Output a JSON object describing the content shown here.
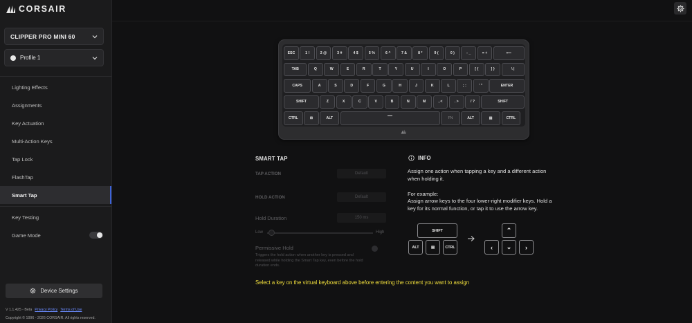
{
  "brand": {
    "name": "CORSAIR"
  },
  "device": {
    "name": "CLIPPER PRO MINI 60"
  },
  "profile": {
    "name": "Profile 1"
  },
  "nav": {
    "items": [
      "Lighting Effects",
      "Assignments",
      "Key Actuation",
      "Multi-Action Keys",
      "Tap Lock",
      "FlashTap",
      "Smart Tap"
    ],
    "active": "Smart Tap",
    "key_testing": "Key Testing",
    "game_mode": "Game Mode"
  },
  "device_settings_label": "Device Settings",
  "footer": {
    "version": "V 1.1.425 - Beta",
    "privacy": "Privacy Policy",
    "terms": "Terms of Use",
    "copyright": "Copyright © 1996 - 2026 CORSAIR. All rights reserved."
  },
  "keyboard": {
    "rows": [
      [
        "ESC",
        "1 !",
        "2 @",
        "3 #",
        "4 $",
        "5 %",
        "6 ^",
        "7 &",
        "8 *",
        "9 (",
        "0 )",
        "- _",
        "= +",
        "⟵"
      ],
      [
        "TAB",
        "Q",
        "W",
        "E",
        "R",
        "T",
        "Y",
        "U",
        "I",
        "O",
        "P",
        "[ {",
        "] }",
        "\\ |"
      ],
      [
        "CAPS",
        "A",
        "S",
        "D",
        "F",
        "G",
        "H",
        "J",
        "K",
        "L",
        "; :",
        "' \"",
        "ENTER"
      ],
      [
        "SHIFT",
        "Z",
        "X",
        "C",
        "V",
        "B",
        "N",
        "M",
        ", <",
        ". >",
        "/ ?",
        "SHIFT"
      ],
      [
        "CTRL",
        "⊞",
        "ALT",
        "",
        "FN",
        "ALT",
        "▤",
        "CTRL"
      ]
    ]
  },
  "smart_tap": {
    "title": "SMART TAP",
    "tap_action_label": "TAP ACTION",
    "tap_action_value": "Default",
    "hold_action_label": "HOLD ACTION",
    "hold_action_value": "Default",
    "hold_duration_label": "Hold Duration",
    "hold_duration_value": "150 ms",
    "slider_low": "Low",
    "slider_high": "High",
    "permissive_label": "Permissive Hold",
    "permissive_desc": "Triggers the hold action when another key is pressed and released while holding the Smart Tap key, even before the hold duration ends."
  },
  "info": {
    "title": "INFO",
    "para1": "Assign one action when tapping a key and a different action when holding it.",
    "para2_head": "For example:",
    "para2": "Assign arrow keys to the four lower-right modifier keys. Hold a key for its normal function, or tap it to use the arrow key.",
    "example_keys": {
      "shift": "SHIFT",
      "alt": "ALT",
      "menu": "▤",
      "ctrl": "CTRL"
    },
    "arrow_keys": {
      "up": "⌃",
      "left": "‹",
      "down": "⌄",
      "right": "›"
    }
  },
  "notice": "Select a key on the virtual keyboard above before entering the content you want to assign"
}
